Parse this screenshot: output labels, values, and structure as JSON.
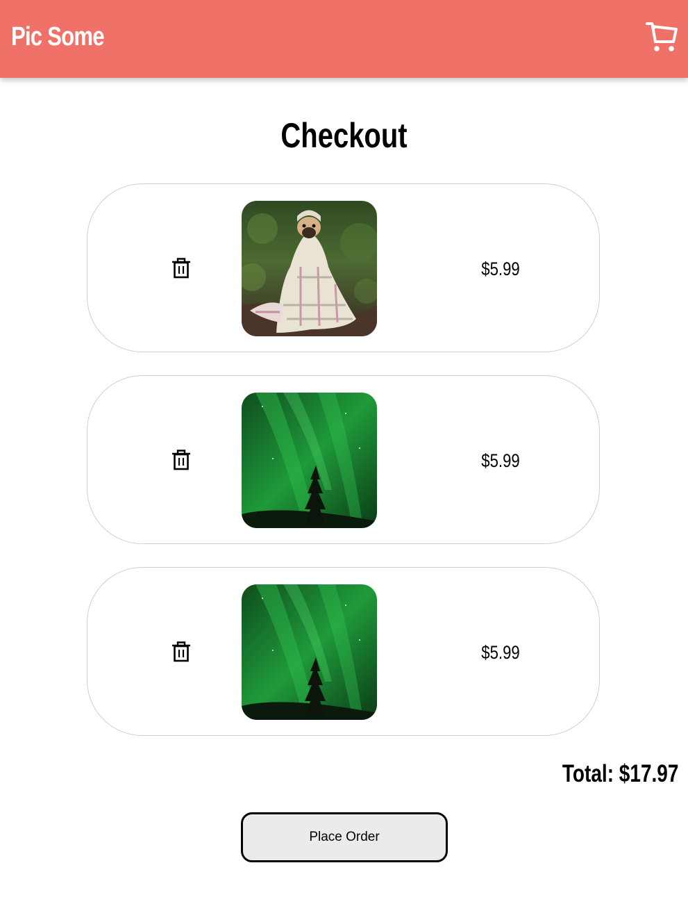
{
  "header": {
    "logo": "Pic Some",
    "cart_icon": "shopping-cart-icon",
    "background_color": "#f07167"
  },
  "page": {
    "title": "Checkout"
  },
  "cart_items": [
    {
      "image": "pug-in-blanket",
      "price": "$5.99",
      "remove_icon": "trash-icon"
    },
    {
      "image": "aurora-green-sky-tree",
      "price": "$5.99",
      "remove_icon": "trash-icon"
    },
    {
      "image": "aurora-green-sky-tree",
      "price": "$5.99",
      "remove_icon": "trash-icon"
    }
  ],
  "summary": {
    "total": "Total: $17.97"
  },
  "actions": {
    "place_order": "Place Order"
  }
}
